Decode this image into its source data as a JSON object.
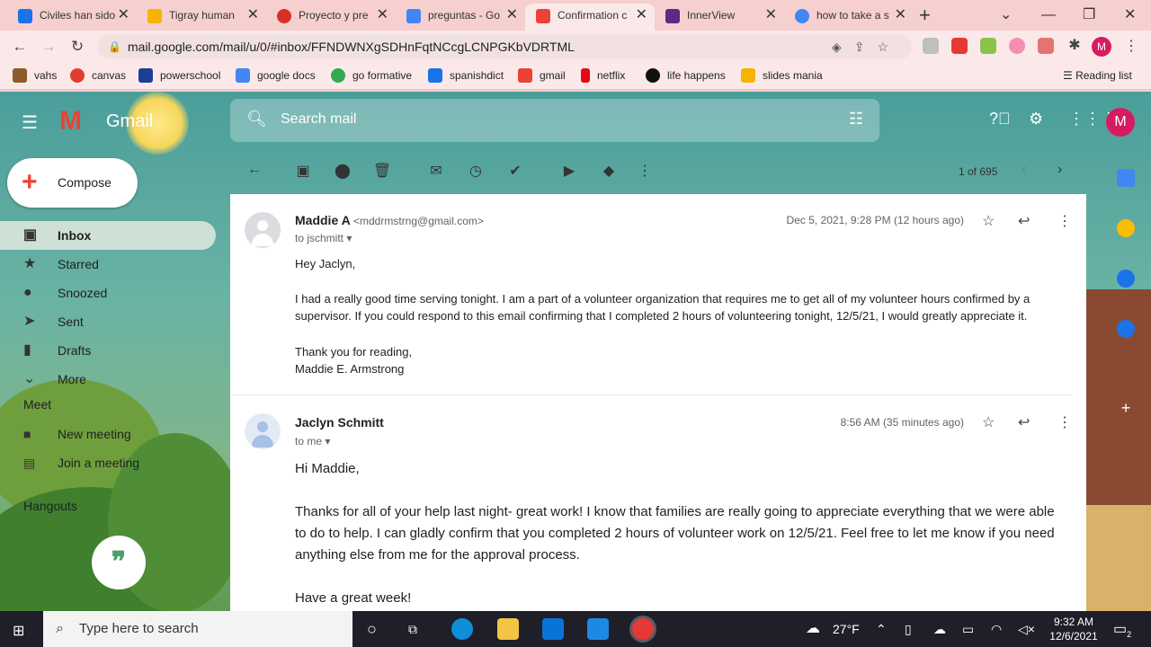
{
  "browser": {
    "tabs": [
      {
        "label": "Civiles han sido",
        "color": "#1a73e8"
      },
      {
        "label": "Tigray human",
        "color": "#f4b400"
      },
      {
        "label": "Proyecto y pre",
        "color": "#d93025"
      },
      {
        "label": "preguntas - Go",
        "color": "#4285f4"
      },
      {
        "label": "Confirmation c",
        "color": "#ea4335"
      },
      {
        "label": "InnerView",
        "color": "#5b2a86"
      },
      {
        "label": "how to take a s",
        "color": "#4285f4"
      }
    ],
    "url": "mail.google.com/mail/u/0/#inbox/FFNDWNXgSDHnFqtNCcgLCNPGKbVDRTML",
    "profile_initial": "M",
    "bookmarks": [
      {
        "label": "vahs",
        "color": "#8d5a2b"
      },
      {
        "label": "canvas",
        "color": "#e03e2d"
      },
      {
        "label": "powerschool",
        "color": "#1c3f94"
      },
      {
        "label": "google docs",
        "color": "#4285f4"
      },
      {
        "label": "go formative",
        "color": "#34a853"
      },
      {
        "label": "spanishdict",
        "color": "#1a73e8"
      },
      {
        "label": "gmail",
        "color": "#ea4335"
      },
      {
        "label": "netflix",
        "color": "#e50914"
      },
      {
        "label": "life happens",
        "color": "#111111"
      },
      {
        "label": "slides mania",
        "color": "#f4b400"
      }
    ],
    "reading_list": "Reading list"
  },
  "gmail": {
    "brand": "Gmail",
    "search_placeholder": "Search mail",
    "avatar_initial": "M",
    "compose_label": "Compose",
    "nav": [
      {
        "label": "Inbox",
        "icon": "inbox-icon"
      },
      {
        "label": "Starred",
        "icon": "star-icon"
      },
      {
        "label": "Snoozed",
        "icon": "clock-icon"
      },
      {
        "label": "Sent",
        "icon": "send-icon"
      },
      {
        "label": "Drafts",
        "icon": "draft-icon"
      },
      {
        "label": "More",
        "icon": "chevron-down-icon"
      }
    ],
    "meet_header": "Meet",
    "meet_items": [
      "New meeting",
      "Join a meeting"
    ],
    "hangouts_header": "Hangouts",
    "pagination": "1 of 695"
  },
  "thread": {
    "messages": [
      {
        "sender": "Maddie A",
        "email": "<mddrmstrng@gmail.com>",
        "to": "to jschmitt",
        "date": "Dec 5, 2021, 9:28 PM (12 hours ago)",
        "body": [
          "Hey Jaclyn,",
          "I had a really good time serving tonight. I am a part of a volunteer organization that requires me to get all of my volunteer hours confirmed by a supervisor. If you could respond to this email confirming that I completed 2 hours of volunteering tonight, 12/5/21, I would greatly appreciate it.",
          "Thank you for reading,",
          "Maddie E. Armstrong"
        ]
      },
      {
        "sender": "Jaclyn Schmitt",
        "to": "to me",
        "date": "8:56 AM (35 minutes ago)",
        "body": [
          "Hi Maddie,",
          "Thanks for all of your help last night- great work! I know that families are really going to appreciate everything that we were able to do to help. I can gladly confirm that you completed 2 hours of volunteer work on 12/5/21. Feel free to let me know if you need anything else from me for the approval process.",
          "Have a great week!"
        ]
      }
    ]
  },
  "taskbar": {
    "search_placeholder": "Type here to search",
    "temperature": "27°F",
    "time": "9:32 AM",
    "date": "12/6/2021",
    "notifications": "2"
  }
}
